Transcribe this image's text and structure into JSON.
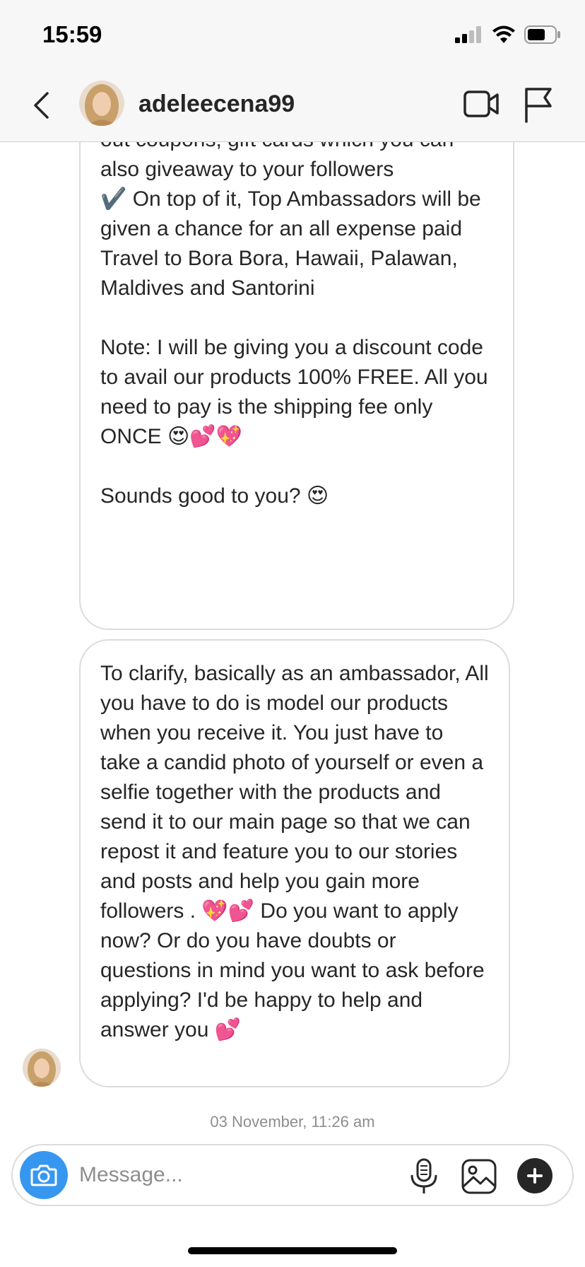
{
  "status_bar": {
    "time": "15:59"
  },
  "header": {
    "username": "adeleecena99",
    "back_icon": "chevron-left-icon",
    "video_icon": "video-camera-icon",
    "report_icon": "flag-icon"
  },
  "messages": [
    {
      "text": "out coupons, gift cards which you can also giveaway to your followers\n✔️ On top of it, Top Ambassadors will be given a chance for an all expense paid Travel to Bora Bora, Hawaii, Palawan, Maldives and Santorini\n\nNote: I will be giving you a discount code to avail our products 100% FREE. All you need to pay is the shipping fee only ONCE 😍💕💖\n\nSounds good to you? 😍"
    },
    {
      "text": "To clarify, basically as an ambassador, All you have to do is model our products when you receive it. You just have to take a candid photo of yourself or even a selfie together with the products and send it to our main page so that we can repost it and feature you to our stories and posts and help you gain more followers . 💖💕 Do you want to apply now? Or do you have doubts or questions in mind you want to ask before applying? I'd be happy to help and answer you 💕"
    }
  ],
  "timestamp": "03 November, 11:26 am",
  "composer": {
    "placeholder": "Message...",
    "camera_icon": "camera-icon",
    "mic_icon": "microphone-icon",
    "gallery_icon": "image-icon",
    "add_icon": "plus-icon",
    "accent_color": "#3797f0"
  }
}
